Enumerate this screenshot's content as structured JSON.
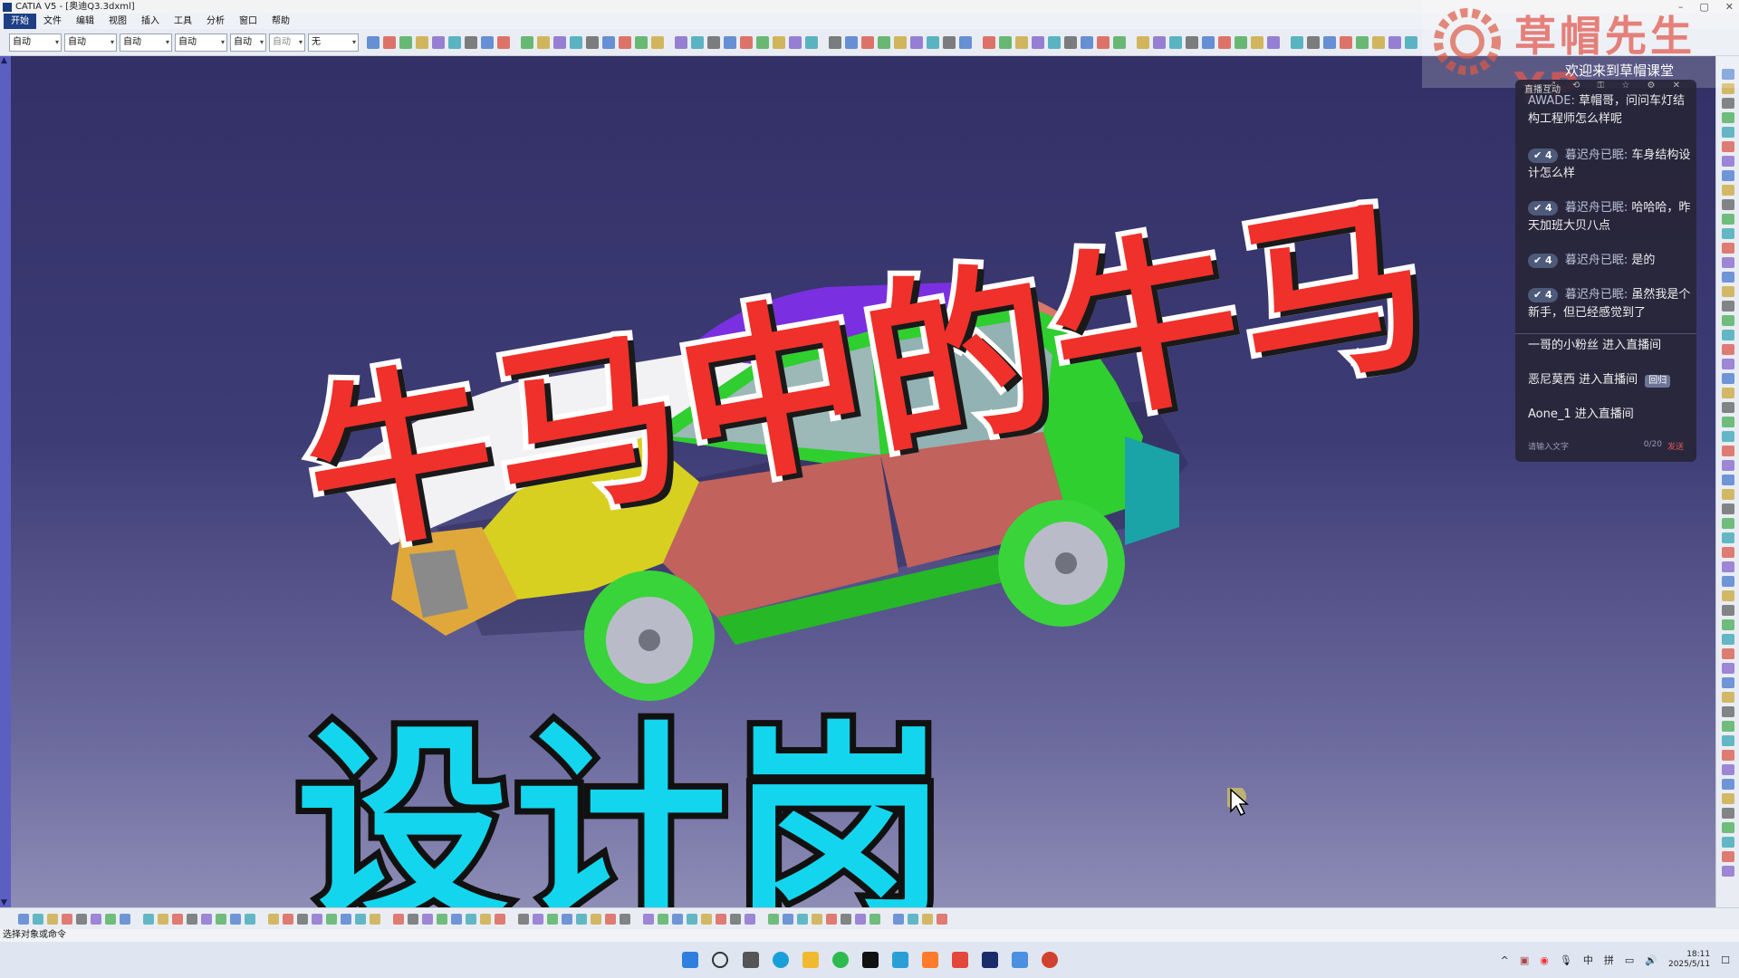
{
  "window": {
    "title": "CATIA V5 - [奥迪Q3.3dxml]",
    "controls": [
      "–",
      "▢",
      "✕"
    ]
  },
  "menu": {
    "items": [
      "开始",
      "文件",
      "编辑",
      "视图",
      "插入",
      "工具",
      "分析",
      "窗口",
      "帮助"
    ]
  },
  "toolbar": {
    "selects": [
      "自动",
      "自动",
      "自动",
      "自动",
      "自动",
      "自动",
      "无"
    ]
  },
  "overlay": {
    "headline1": "牛马中的牛马",
    "headline2": "设计岗"
  },
  "watermark": {
    "brand": "草帽先生YP",
    "welcome": "欢迎来到草帽课堂"
  },
  "chat": {
    "header": "直播互动",
    "header_icons": "⤢ ⟲ ⚿ ☆ ⚙ ✕",
    "messages": [
      {
        "level": "4",
        "user": "AWADE:",
        "text": "草帽哥，问问车灯结构工程师怎么样呢"
      },
      {
        "level": "4",
        "user": "暮迟舟已眠:",
        "text": "车身结构设计怎么样"
      },
      {
        "level": "4",
        "user": "暮迟舟已眠:",
        "text": "哈哈哈，昨天加班大贝八点"
      },
      {
        "level": "4",
        "user": "暮迟舟已眠:",
        "text": "是的"
      },
      {
        "level": "4",
        "user": "暮迟舟已眠:",
        "text": "虽然我是个新手，但已经感觉到了"
      }
    ],
    "events": [
      {
        "text": "一哥的小粉丝 进入直播间"
      },
      {
        "text": "恶尼莫西 进入直播间",
        "badge": "回归"
      },
      {
        "text": "Aone_1 进入直播间"
      }
    ],
    "input_placeholder": "请输入文字",
    "count": "0/20",
    "send": "发送"
  },
  "status": {
    "text": "选择对象或命令"
  },
  "clock": {
    "time": "18:11",
    "date": "2025/5/11"
  },
  "tray": {
    "ime1": "中",
    "ime2": "拼"
  },
  "colors": {
    "viewport_top": "#323066",
    "headline_red": "#f0302a",
    "headline_cyan": "#13d6ee"
  }
}
